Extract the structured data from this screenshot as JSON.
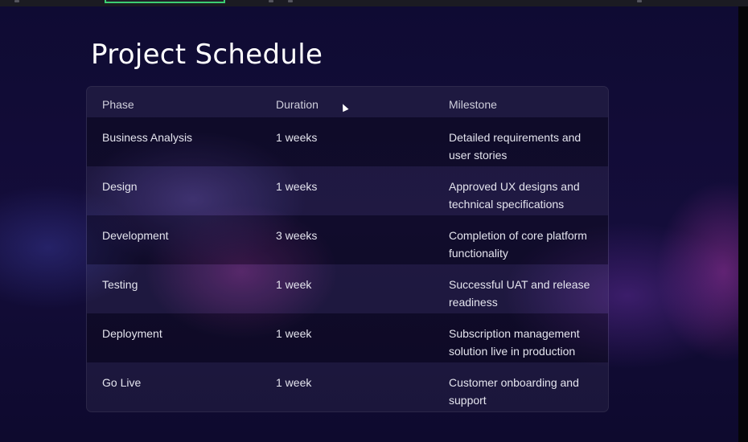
{
  "slide": {
    "title": "Project Schedule"
  },
  "table": {
    "columns": [
      "Phase",
      "Duration",
      "Milestone"
    ],
    "rows": [
      {
        "phase": "Business Analysis",
        "duration": "1 weeks",
        "milestone": "Detailed requirements and user stories"
      },
      {
        "phase": "Design",
        "duration": "1 weeks",
        "milestone": "Approved UX designs and technical specifications"
      },
      {
        "phase": "Development",
        "duration": "3 weeks",
        "milestone": "Completion of core platform functionality"
      },
      {
        "phase": "Testing",
        "duration": "1 week",
        "milestone": "Successful UAT and release readiness"
      },
      {
        "phase": "Deployment",
        "duration": "1 week",
        "milestone": "Subscription management solution live in production"
      },
      {
        "phase": "Go Live",
        "duration": "1 week",
        "milestone": "Customer onboarding and support"
      }
    ]
  },
  "icons": {
    "cursor": "mouse-pointer-icon"
  },
  "colors": {
    "background": "#0f0b33",
    "tab_highlight": "#3ccf73",
    "text": "#ffffff"
  }
}
